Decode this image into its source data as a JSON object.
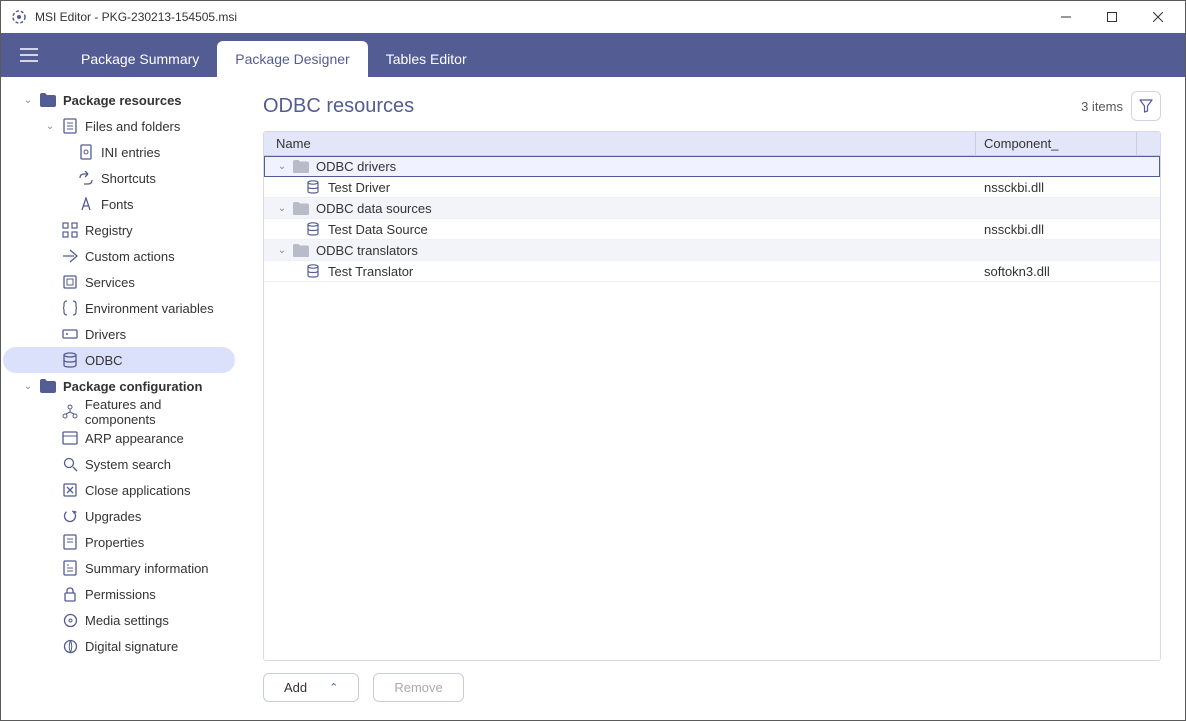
{
  "window": {
    "title": "MSI Editor - PKG-230213-154505.msi"
  },
  "tabs": {
    "summary": "Package Summary",
    "designer": "Package Designer",
    "tables": "Tables Editor"
  },
  "sidebar": {
    "groups": [
      {
        "label": "Package resources",
        "items": [
          {
            "label": "Files and folders",
            "icon": "file-icon",
            "children": [
              {
                "label": "INI entries",
                "icon": "ini-icon"
              },
              {
                "label": "Shortcuts",
                "icon": "shortcut-icon"
              },
              {
                "label": "Fonts",
                "icon": "font-icon"
              }
            ]
          },
          {
            "label": "Registry",
            "icon": "registry-icon"
          },
          {
            "label": "Custom actions",
            "icon": "actions-icon"
          },
          {
            "label": "Services",
            "icon": "services-icon"
          },
          {
            "label": "Environment variables",
            "icon": "env-icon"
          },
          {
            "label": "Drivers",
            "icon": "drivers-icon"
          },
          {
            "label": "ODBC",
            "icon": "odbc-icon",
            "selected": true
          }
        ]
      },
      {
        "label": "Package configuration",
        "items": [
          {
            "label": "Features and components",
            "icon": "features-icon"
          },
          {
            "label": "ARP appearance",
            "icon": "arp-icon"
          },
          {
            "label": "System search",
            "icon": "search-icon"
          },
          {
            "label": "Close applications",
            "icon": "close-app-icon"
          },
          {
            "label": "Upgrades",
            "icon": "upgrades-icon"
          },
          {
            "label": "Properties",
            "icon": "properties-icon"
          },
          {
            "label": "Summary information",
            "icon": "summary-icon"
          },
          {
            "label": "Permissions",
            "icon": "permissions-icon"
          },
          {
            "label": "Media settings",
            "icon": "media-icon"
          },
          {
            "label": "Digital signature",
            "icon": "signature-icon"
          }
        ]
      }
    ]
  },
  "page": {
    "title": "ODBC resources",
    "count": "3 items"
  },
  "grid": {
    "columns": {
      "name": "Name",
      "component": "Component_"
    },
    "groups": [
      {
        "label": "ODBC drivers",
        "items": [
          {
            "name": "Test Driver",
            "component": "nssckbi.dll"
          }
        ]
      },
      {
        "label": "ODBC data sources",
        "items": [
          {
            "name": "Test Data Source",
            "component": "nssckbi.dll"
          }
        ]
      },
      {
        "label": "ODBC translators",
        "items": [
          {
            "name": "Test Translator",
            "component": "softokn3.dll"
          }
        ]
      }
    ]
  },
  "footer": {
    "add": "Add",
    "remove": "Remove"
  }
}
